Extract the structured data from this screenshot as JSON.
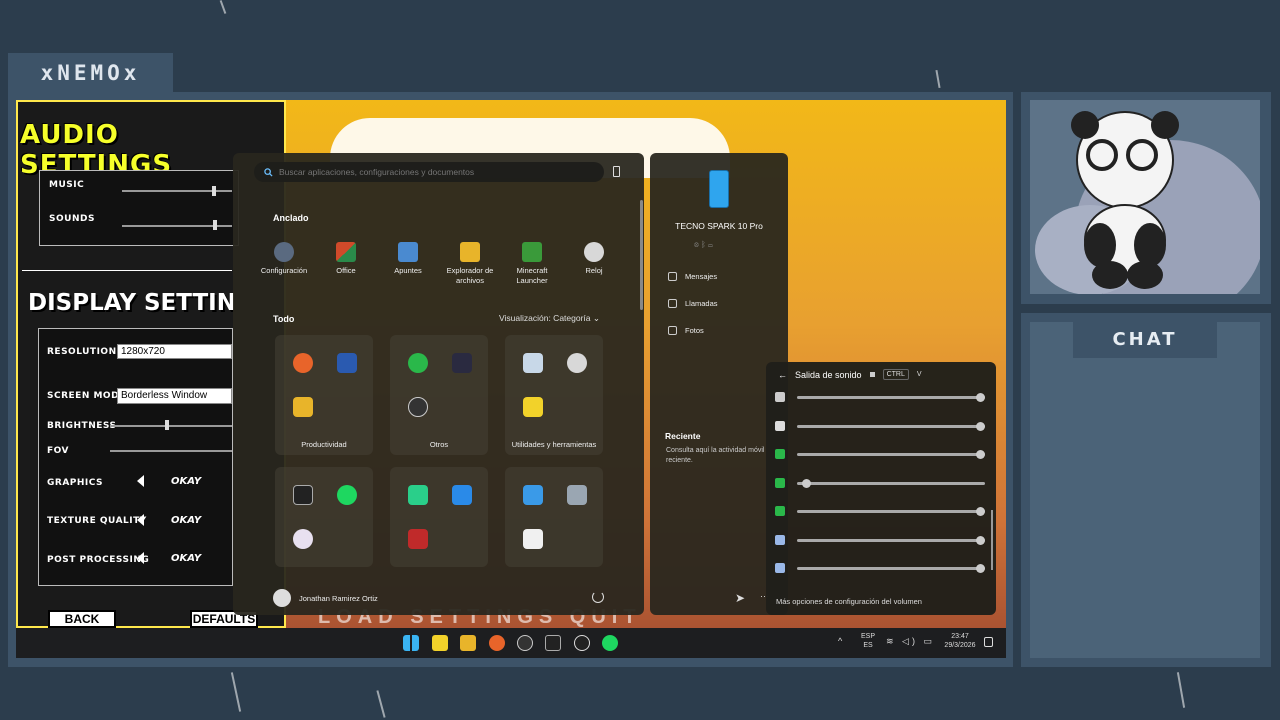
{
  "overlay": {
    "streamer_name": "xNEMOx",
    "chat_title": "CHAT"
  },
  "game": {
    "audio_title": "AUDIO SETTINGS",
    "music_label": "MUSIC",
    "sounds_label": "SOUNDS",
    "display_title": "DISPLAY SETTIN",
    "resolution_label": "RESOLUTION",
    "resolution_value": "1280x720",
    "screen_mode_label": "SCREEN MODE",
    "screen_mode_value": "Borderless Window",
    "brightness_label": "BRIGHTNESS",
    "fov_label": "FOV",
    "graphics_label": "GRAPHICS",
    "graphics_value": "OKAY",
    "texture_label": "TEXTURE QUALITY",
    "texture_value": "OKAY",
    "post_label": "POST PROCESSING",
    "post_value": "OKAY",
    "back_button": "BACK",
    "defaults_button": "DEFAULTS",
    "bottom_banner": "LOAD SETTINGS QUIT"
  },
  "start_menu": {
    "search_placeholder": "Buscar aplicaciones, configuraciones y documentos",
    "pinned_title": "Anclado",
    "pinned": [
      {
        "label": "Configuración",
        "color": "#5a6a80"
      },
      {
        "label": "Office",
        "color": "#d04a2a"
      },
      {
        "label": "Apuntes",
        "color": "#4a8ad0"
      },
      {
        "label": "Explorador de archivos",
        "color": "#e8b42a"
      },
      {
        "label": "Minecraft Launcher",
        "color": "#3a9a3a"
      },
      {
        "label": "Reloj",
        "color": "#d8d8d8"
      }
    ],
    "all_title": "Todo",
    "view_label": "Visualización: Categoría",
    "categories": [
      {
        "label": "Productividad"
      },
      {
        "label": "Otros"
      },
      {
        "label": "Utilidades y herramientas"
      }
    ],
    "user_name": "Jonathan Ramirez Ortiz"
  },
  "phone": {
    "device_name": "TECNO SPARK 10 Pro",
    "items": [
      "Mensajes",
      "Llamadas",
      "Fotos"
    ],
    "recent_title": "Reciente",
    "recent_text": "Consulta aquí la actividad móvil reciente."
  },
  "mixer": {
    "title": "Salida de sonido",
    "shortcut_key1": "CTRL",
    "shortcut_key2": "V",
    "levels": [
      100,
      100,
      100,
      3,
      100,
      100,
      100
    ],
    "more_options": "Más opciones de configuración del volumen"
  },
  "taskbar": {
    "lang_top": "ESP",
    "lang_bottom": "ES",
    "time": "23:47",
    "date": "29/3/2026"
  }
}
